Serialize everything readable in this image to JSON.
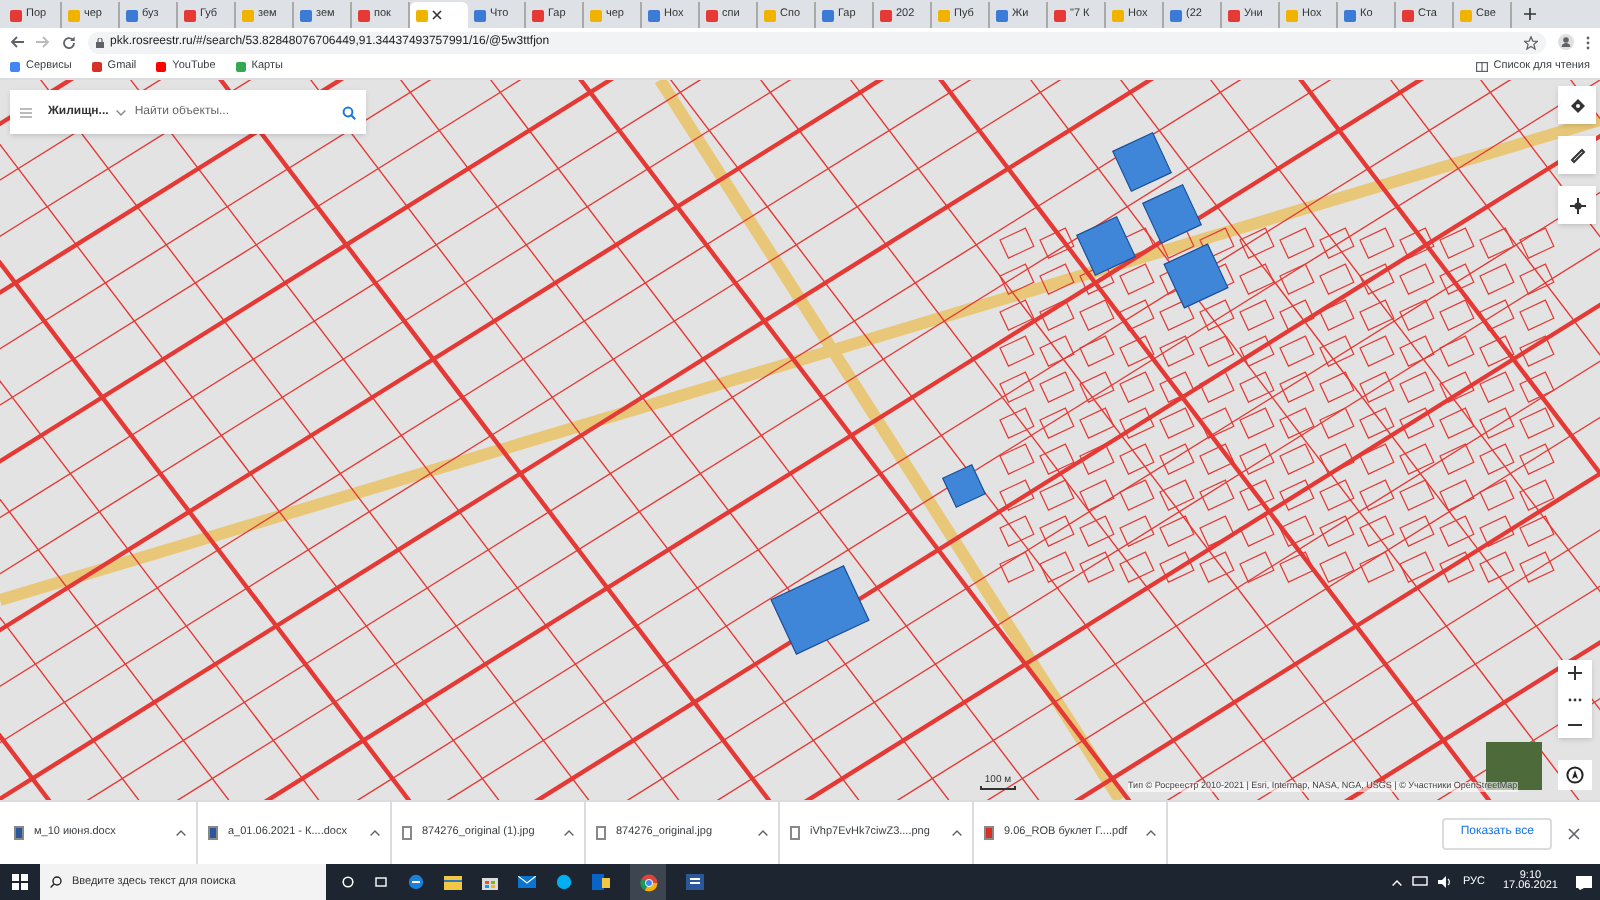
{
  "tabs": [
    {
      "label": "Пор",
      "selected": false
    },
    {
      "label": "чер",
      "selected": false
    },
    {
      "label": "буз",
      "selected": false
    },
    {
      "label": "Губ",
      "selected": false
    },
    {
      "label": "зем",
      "selected": false
    },
    {
      "label": "зем",
      "selected": false
    },
    {
      "label": "пок",
      "selected": false
    },
    {
      "selected": true
    },
    {
      "label": "Что",
      "selected": false
    },
    {
      "label": "Гар",
      "selected": false
    },
    {
      "label": "чер",
      "selected": false
    },
    {
      "label": "Нох",
      "selected": false
    },
    {
      "label": "спи",
      "selected": false
    },
    {
      "label": "Спо",
      "selected": false
    },
    {
      "label": "Гар",
      "selected": false
    },
    {
      "label": "202",
      "selected": false
    },
    {
      "label": "Пуб",
      "selected": false
    },
    {
      "label": "Жи",
      "selected": false
    },
    {
      "label": "\"7 К",
      "selected": false
    },
    {
      "label": "Нох",
      "selected": false
    },
    {
      "label": "(22",
      "selected": false
    },
    {
      "label": "Уни",
      "selected": false
    },
    {
      "label": "Нох",
      "selected": false
    },
    {
      "label": "Ко",
      "selected": false
    },
    {
      "label": "Ста",
      "selected": false
    },
    {
      "label": "Све",
      "selected": false
    }
  ],
  "address": "pkk.rosreestr.ru/#/search/53.82848076706449,91.34437493757991/16/@5w3ttfjon",
  "bookmarks": [
    "Сервисы",
    "Gmail",
    "YouTube",
    "Карты"
  ],
  "reading_list": "Список для чтения",
  "map_search": {
    "category": "Жилищн...",
    "placeholder": "Найти объекты..."
  },
  "scale": "100 м",
  "attribution": "Тип © Росреестр 2010-2021 | Esri, Intermap, NASA, NGA, USGS | © Участники OpenStreetMap",
  "downloads": [
    "м_10 июня.docx",
    "а_01.06.2021 - К....docx",
    "874276_original (1).jpg",
    "874276_original.jpg",
    "iVhp7EvHk7ciwZ3....png",
    "9.06_ROB буклет Г....pdf"
  ],
  "show_all": "Показать все",
  "taskbar": {
    "search_placeholder": "Введите здесь текст для поиска",
    "language": "РУС",
    "time": "9:10",
    "date": "17.06.2021"
  }
}
